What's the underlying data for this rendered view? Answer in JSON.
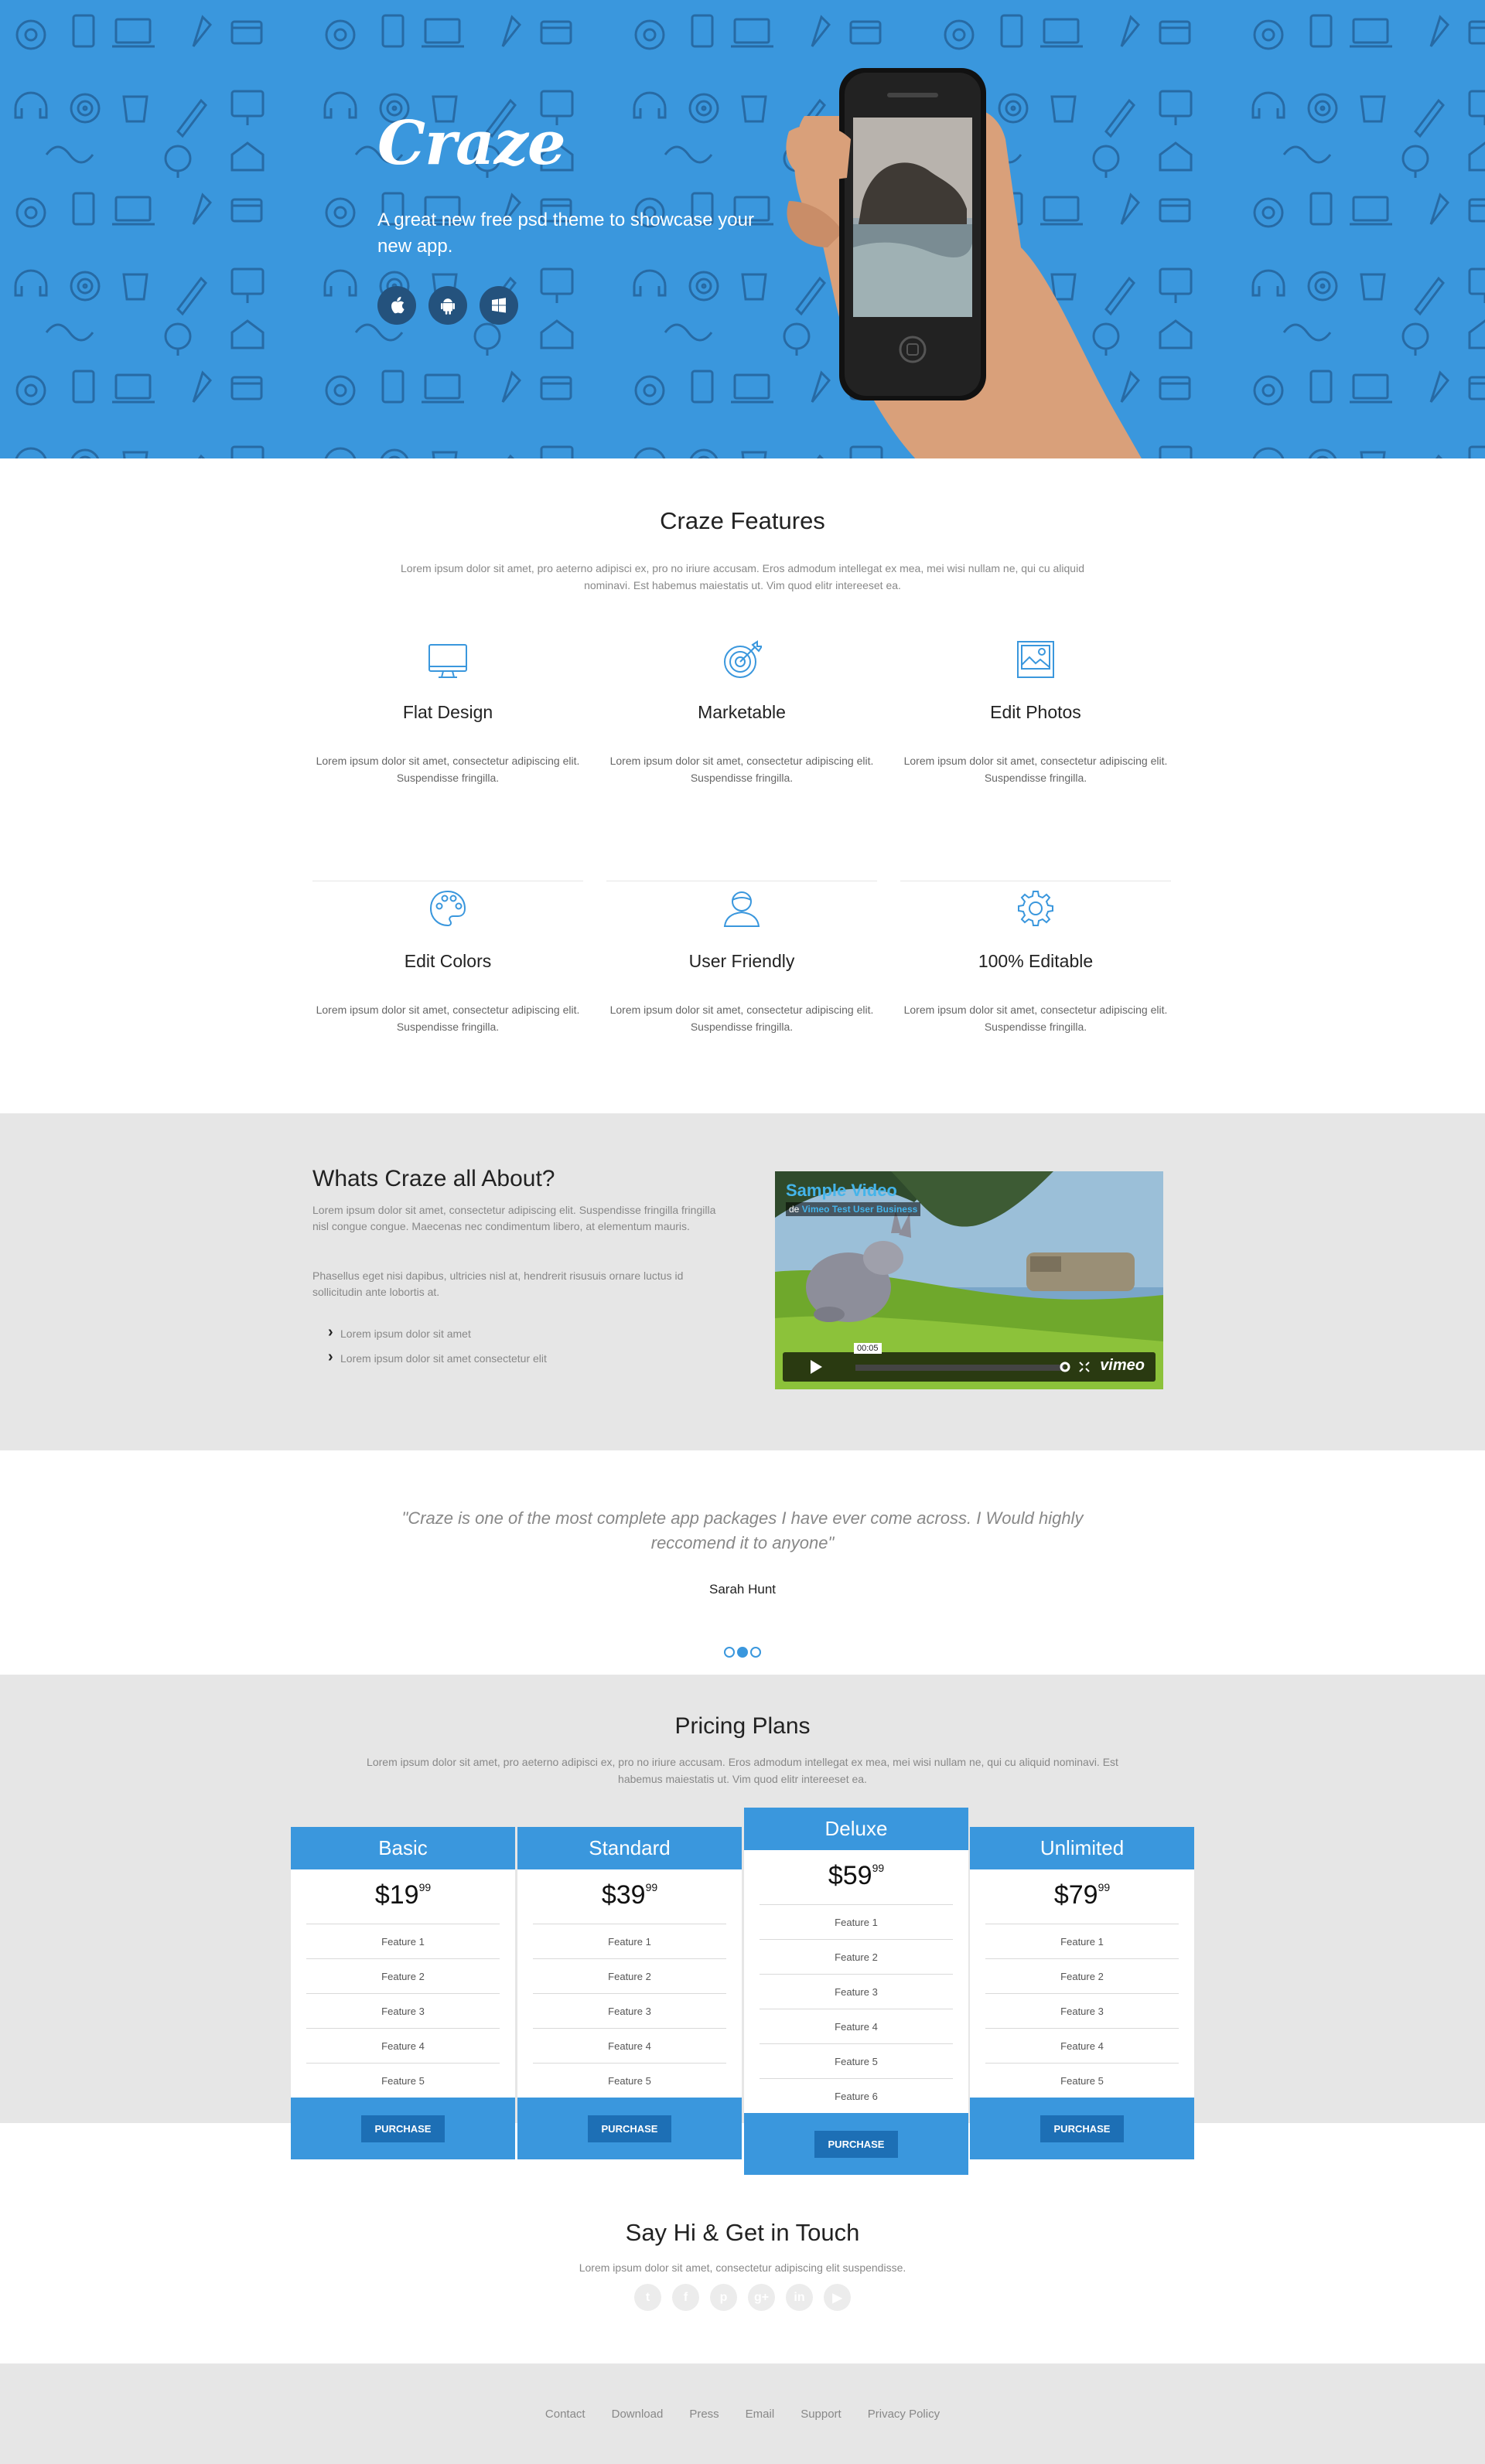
{
  "hero": {
    "logo": "Craze",
    "tagline": "A great new free psd theme to showcase your new app.",
    "store_buttons": [
      "apple-icon",
      "android-icon",
      "windows-icon"
    ],
    "background_color": "#3a97dd"
  },
  "features": {
    "title": "Craze Features",
    "subtitle": "Lorem ipsum dolor sit amet, pro aeterno adipisci ex, pro no iriure accusam. Eros admodum intellegat ex mea, mei wisi nullam ne, qui cu aliquid nominavi. Est habemus maiestatis ut. Vim quod elitr intereeset ea.",
    "items": [
      {
        "icon": "monitor-icon",
        "title": "Flat Design",
        "text": "Lorem ipsum dolor sit amet, consectetur adipiscing elit. Suspendisse fringilla."
      },
      {
        "icon": "target-icon",
        "title": "Marketable",
        "text": "Lorem ipsum dolor sit amet, consectetur adipiscing elit. Suspendisse fringilla."
      },
      {
        "icon": "image-icon",
        "title": "Edit Photos",
        "text": "Lorem ipsum dolor sit amet, consectetur adipiscing elit. Suspendisse fringilla."
      },
      {
        "icon": "palette-icon",
        "title": "Edit Colors",
        "text": "Lorem ipsum dolor sit amet, consectetur adipiscing elit. Suspendisse fringilla."
      },
      {
        "icon": "user-icon",
        "title": "User Friendly",
        "text": "Lorem ipsum dolor sit amet, consectetur adipiscing elit. Suspendisse fringilla."
      },
      {
        "icon": "gear-icon",
        "title": "100% Editable",
        "text": "Lorem ipsum dolor sit amet, consectetur adipiscing elit. Suspendisse fringilla."
      }
    ]
  },
  "about": {
    "title": "Whats Craze all About?",
    "p1": "Lorem ipsum dolor sit amet, consectetur adipiscing elit. Suspendisse fringilla fringilla nisl congue congue. Maecenas nec condimentum libero, at elementum mauris.",
    "p2": "Phasellus eget nisi dapibus, ultricies nisl at, hendrerit risusuis ornare luctus id sollicitudin ante lobortis at.",
    "bullets": [
      "Lorem ipsum dolor sit amet",
      "Lorem ipsum dolor sit amet consectetur elit"
    ],
    "video": {
      "title": "Sample Video",
      "by_prefix": "de",
      "by_name": "Vimeo Test User Business",
      "time": "00:05",
      "logo": "vimeo"
    }
  },
  "testimonial": {
    "quote": "\"Craze is one of the most complete app packages I have ever come across. I Would highly reccomend it to anyone\"",
    "author": "Sarah Hunt",
    "dots_active_index": 1
  },
  "pricing": {
    "title": "Pricing Plans",
    "subtitle": "Lorem ipsum dolor sit amet, pro aeterno adipisci ex, pro no iriure accusam. Eros admodum intellegat ex mea, mei wisi nullam ne, qui cu aliquid nominavi. Est habemus maiestatis ut. Vim quod elitr intereeset ea.",
    "plans": [
      {
        "name": "Basic",
        "price": "$19",
        "cents": "99",
        "features": [
          "Feature 1",
          "Feature 2",
          "Feature 3",
          "Feature 4",
          "Feature 5"
        ],
        "button": "PURCHASE"
      },
      {
        "name": "Standard",
        "price": "$39",
        "cents": "99",
        "features": [
          "Feature 1",
          "Feature 2",
          "Feature 3",
          "Feature 4",
          "Feature 5"
        ],
        "button": "PURCHASE"
      },
      {
        "name": "Deluxe",
        "price": "$59",
        "cents": "99",
        "features": [
          "Feature 1",
          "Feature 2",
          "Feature 3",
          "Feature 4",
          "Feature 5",
          "Feature 6"
        ],
        "button": "PURCHASE"
      },
      {
        "name": "Unlimited",
        "price": "$79",
        "cents": "99",
        "features": [
          "Feature 1",
          "Feature 2",
          "Feature 3",
          "Feature 4",
          "Feature 5"
        ],
        "button": "PURCHASE"
      }
    ]
  },
  "contact": {
    "title": "Say Hi & Get in Touch",
    "subtitle": "Lorem ipsum dolor sit amet, consectetur adipiscing elit suspendisse.",
    "socials": [
      {
        "icon": "twitter-icon",
        "glyph": "t"
      },
      {
        "icon": "facebook-icon",
        "glyph": "f"
      },
      {
        "icon": "pinterest-icon",
        "glyph": "p"
      },
      {
        "icon": "google-plus-icon",
        "glyph": "g+"
      },
      {
        "icon": "linkedin-icon",
        "glyph": "in"
      },
      {
        "icon": "youtube-icon",
        "glyph": "▶"
      }
    ]
  },
  "footer": {
    "links": [
      "Contact",
      "Download",
      "Press",
      "Email",
      "Support",
      "Privacy Policy"
    ]
  }
}
